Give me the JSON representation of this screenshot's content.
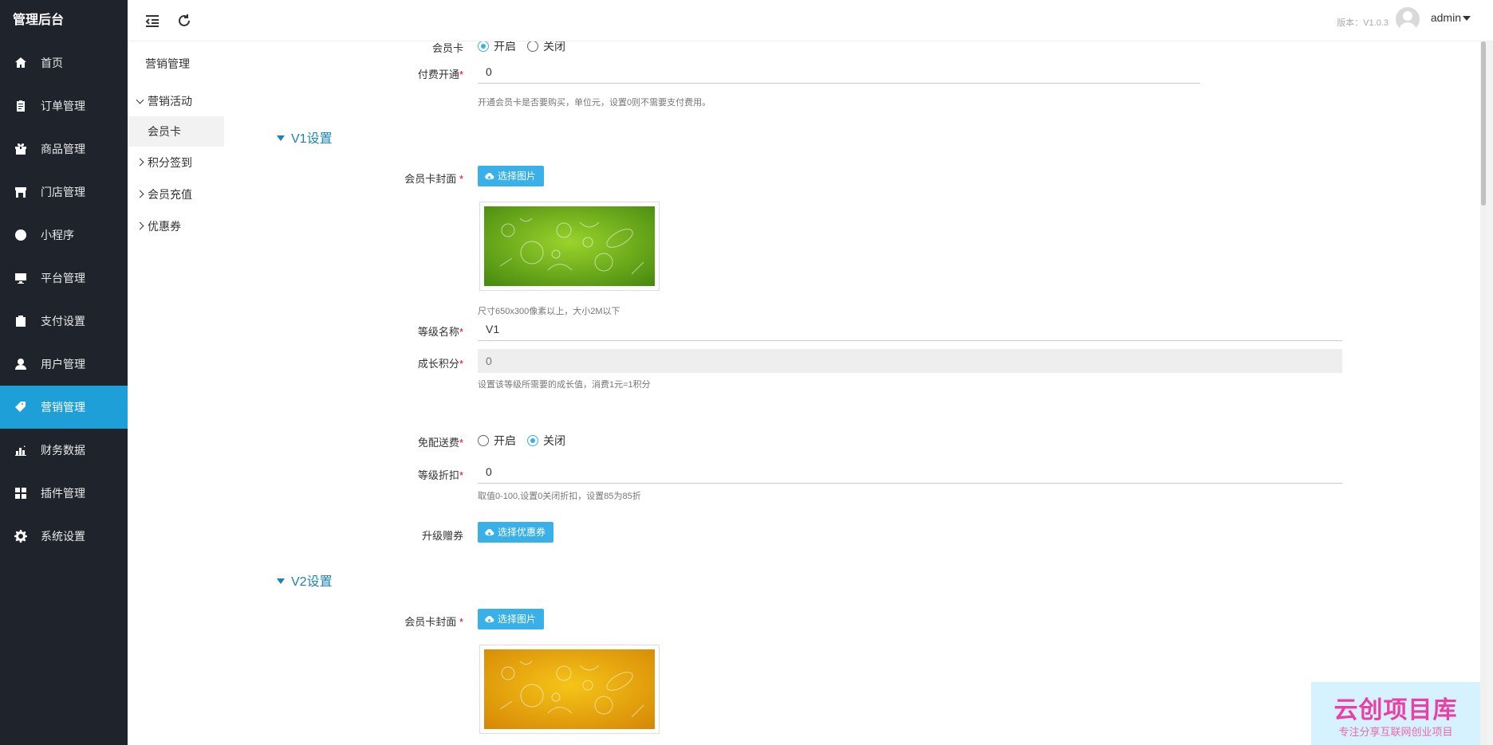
{
  "app": {
    "brand": "管理后台",
    "version": "版本：V1.0.3",
    "user": "admin"
  },
  "sidebar": {
    "items": [
      {
        "label": "首页",
        "icon": "home-icon"
      },
      {
        "label": "订单管理",
        "icon": "clipboard-icon"
      },
      {
        "label": "商品管理",
        "icon": "gift-icon"
      },
      {
        "label": "门店管理",
        "icon": "store-icon"
      },
      {
        "label": "小程序",
        "icon": "mini-program-icon"
      },
      {
        "label": "平台管理",
        "icon": "monitor-icon"
      },
      {
        "label": "支付设置",
        "icon": "wallet-icon"
      },
      {
        "label": "用户管理",
        "icon": "user-icon"
      },
      {
        "label": "营销管理",
        "icon": "tag-icon",
        "active": true
      },
      {
        "label": "财务数据",
        "icon": "bar-chart-icon"
      },
      {
        "label": "插件管理",
        "icon": "plugin-icon"
      },
      {
        "label": "系统设置",
        "icon": "gear-icon"
      }
    ]
  },
  "subnav": {
    "title": "营销管理",
    "groups": [
      {
        "label": "营销活动",
        "expanded": true,
        "children": [
          "会员卡"
        ]
      },
      {
        "label": "积分签到"
      },
      {
        "label": "会员充值"
      },
      {
        "label": "优惠券"
      }
    ]
  },
  "form": {
    "member_card": {
      "label": "会员卡",
      "options": [
        "开启",
        "关闭"
      ],
      "selected": "开启"
    },
    "paid_open": {
      "label": "付费开通",
      "value": "0",
      "hint": "开通会员卡是否要购买，单位元，设置0则不需要支付费用。"
    },
    "v1": {
      "title": "V1设置",
      "cover_label": "会员卡封面",
      "choose_image": "选择图片",
      "cover_hint": "尺寸650x300像素以上，大小2M以下",
      "level_name_label": "等级名称",
      "level_name": "V1",
      "growth_label": "成长积分",
      "growth_value": "0",
      "growth_hint": "设置该等级所需要的成长值，消费1元=1积分",
      "free_shipping_label": "免配送费",
      "free_shipping_options": [
        "开启",
        "关闭"
      ],
      "free_shipping_selected": "关闭",
      "discount_label": "等级折扣",
      "discount_value": "0",
      "discount_hint": "取值0-100,设置0关闭折扣，设置85为85折",
      "upgrade_label": "升级赠券",
      "choose_coupon": "选择优惠券"
    },
    "v2": {
      "title": "V2设置",
      "cover_label": "会员卡封面",
      "choose_image": "选择图片"
    }
  },
  "watermark": {
    "title": "云创项目库",
    "sub": "专注分享互联网创业项目"
  }
}
